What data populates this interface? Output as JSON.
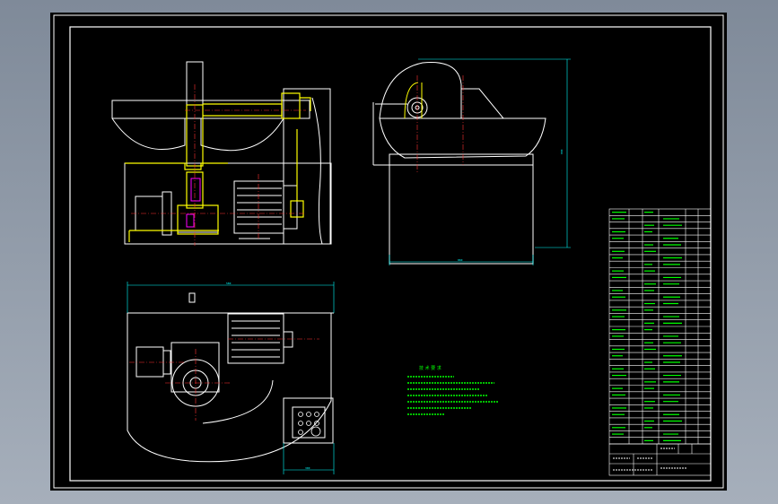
{
  "colors": {
    "background": "#000000",
    "frame": "#ffffff",
    "outline": "#ffffff",
    "highlight": "#ffff00",
    "dimension": "#00ffff",
    "centerline": "#ff3333",
    "notes": "#00ff00",
    "magenta": "#ff00ff"
  },
  "dimensions": {
    "side_height": "800",
    "side_width": "860",
    "plan_width": "580",
    "panel_width": "300"
  },
  "notes_title": "技 术 要 求",
  "notes": [
    "",
    "",
    "",
    "",
    ""
  ],
  "parts_table": {
    "rows": 36,
    "columns": 6
  },
  "title_block": {
    "label": "",
    "scale": "",
    "sheets": ""
  }
}
